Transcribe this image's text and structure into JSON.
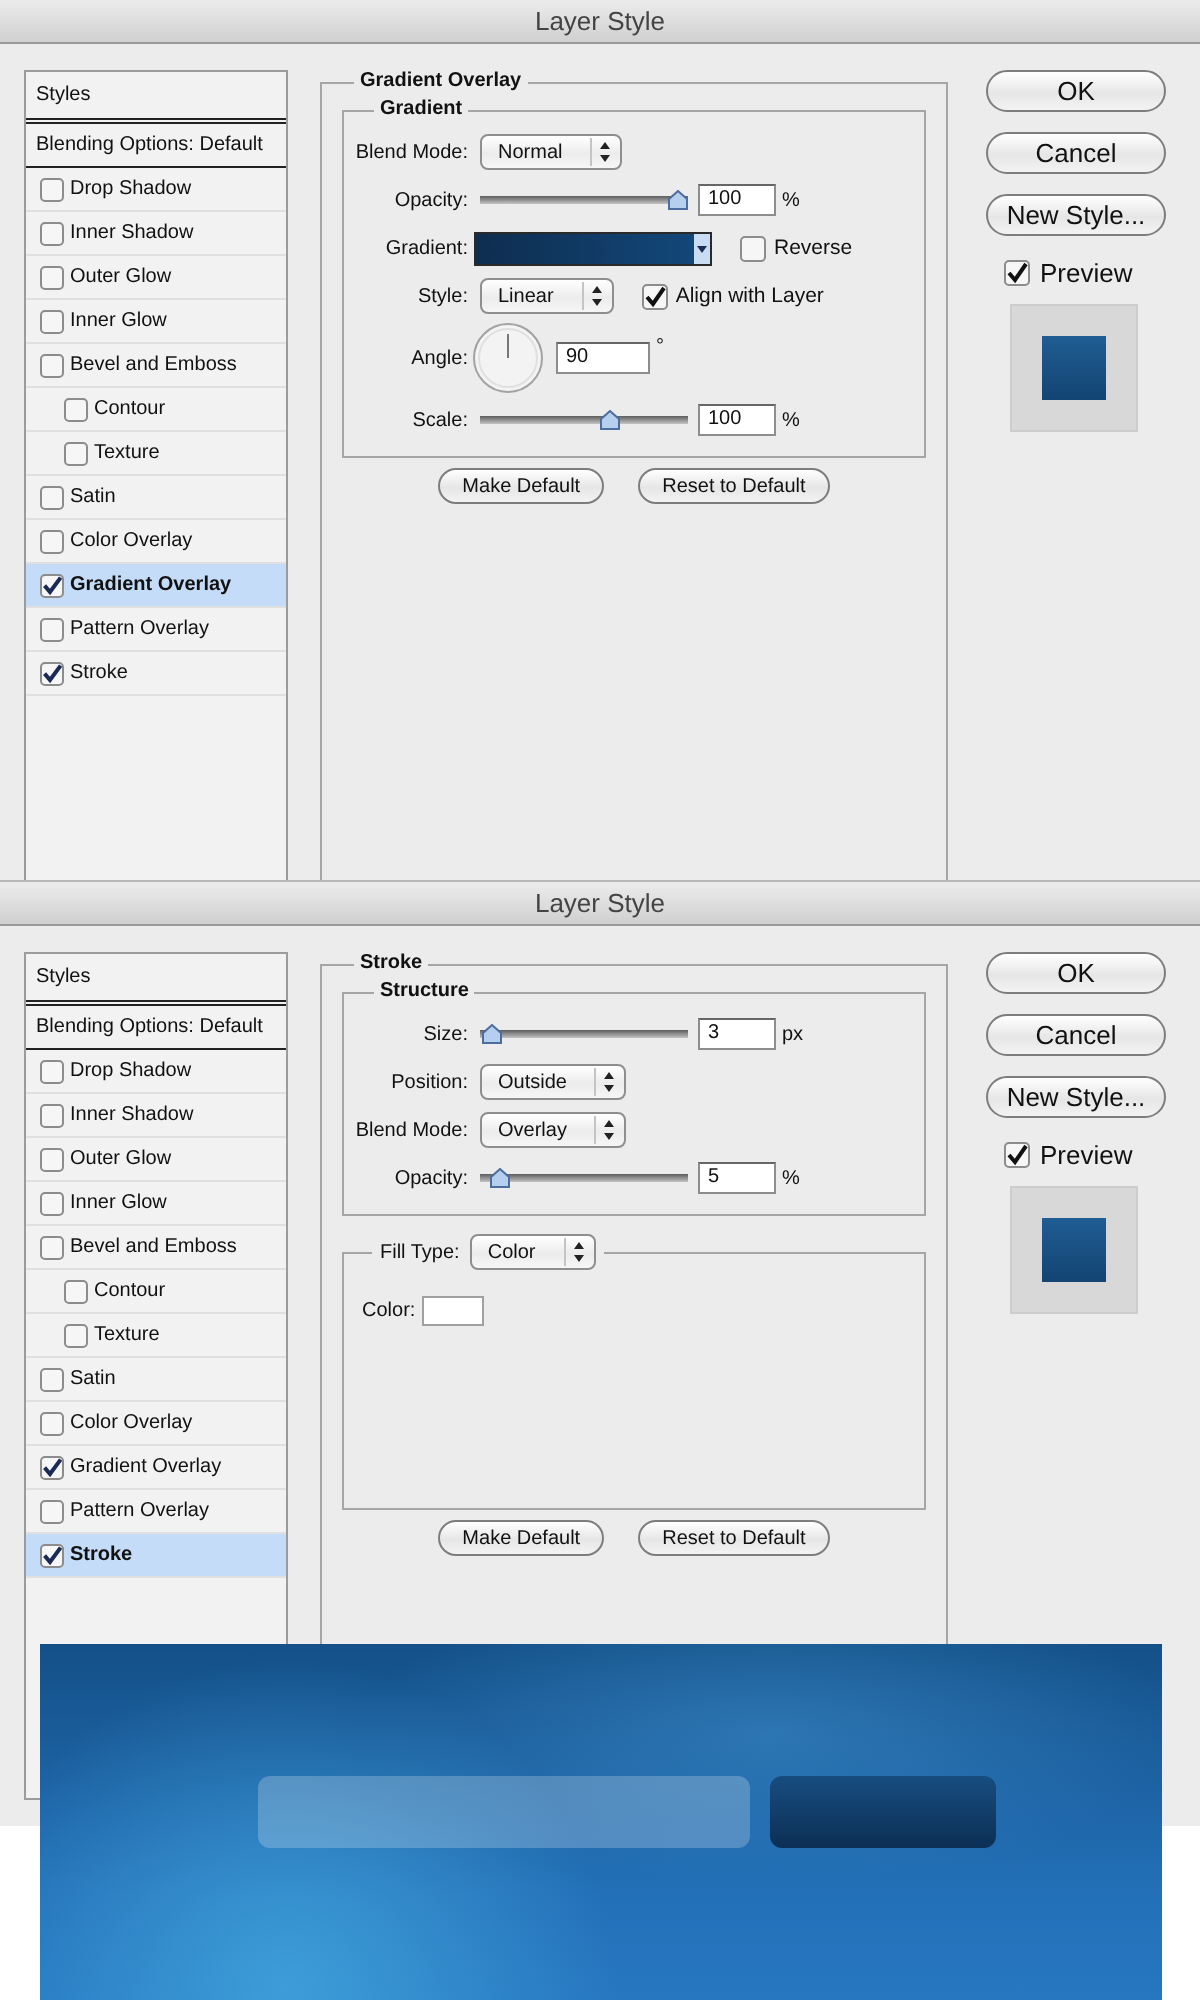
{
  "dialogs": [
    {
      "title": "Layer Style",
      "styles_panel": {
        "items": [
          {
            "kind": "pane",
            "label": "Styles",
            "selected": false
          },
          {
            "kind": "pane",
            "label": "Blending Options: Default",
            "selected": false
          },
          {
            "kind": "effect",
            "label": "Drop Shadow",
            "checked": false,
            "selected": false
          },
          {
            "kind": "effect",
            "label": "Inner Shadow",
            "checked": false,
            "selected": false
          },
          {
            "kind": "effect",
            "label": "Outer Glow",
            "checked": false,
            "selected": false
          },
          {
            "kind": "effect",
            "label": "Inner Glow",
            "checked": false,
            "selected": false
          },
          {
            "kind": "effect",
            "label": "Bevel and Emboss",
            "checked": false,
            "selected": false,
            "children": [
              {
                "kind": "effect",
                "label": "Contour",
                "checked": false,
                "selected": false
              },
              {
                "kind": "effect",
                "label": "Texture",
                "checked": false,
                "selected": false
              }
            ]
          },
          {
            "kind": "effect",
            "label": "Satin",
            "checked": false,
            "selected": false
          },
          {
            "kind": "effect",
            "label": "Color Overlay",
            "checked": false,
            "selected": false
          },
          {
            "kind": "effect",
            "label": "Gradient Overlay",
            "checked": true,
            "selected": true
          },
          {
            "kind": "effect",
            "label": "Pattern Overlay",
            "checked": false,
            "selected": false
          },
          {
            "kind": "effect",
            "label": "Stroke",
            "checked": true,
            "selected": false
          }
        ]
      },
      "settings": {
        "title": "Gradient Overlay",
        "groups": [
          {
            "kind": "titled",
            "title": "Gradient",
            "rows": [
              {
                "kind": "dropdown",
                "label": "Blend Mode:",
                "value": "Normal"
              },
              {
                "kind": "slider",
                "label": "Opacity:",
                "level": 1,
                "value": "100",
                "unit": "%"
              },
              {
                "kind": "gradient",
                "label": "Gradient:",
                "checkbox": {
                  "label": "Reverse",
                  "checked": false
                }
              },
              {
                "kind": "dropdown",
                "label": "Style:",
                "value": "Linear",
                "checkbox": {
                  "label": "Align with Layer",
                  "checked": true
                }
              },
              {
                "kind": "angle",
                "label": "Angle:",
                "value": "90",
                "unit": "°"
              },
              {
                "kind": "slider",
                "label": "Scale:",
                "level": 0.64,
                "value": "100",
                "unit": "%"
              }
            ]
          }
        ],
        "buttons": [
          "Make Default",
          "Reset to Default"
        ]
      },
      "actions": {
        "buttons": [
          "OK",
          "Cancel",
          "New Style..."
        ],
        "preview": {
          "label": "Preview",
          "checked": true
        }
      }
    },
    {
      "title": "Layer Style",
      "styles_panel": {
        "items": [
          {
            "kind": "pane",
            "label": "Styles",
            "selected": false
          },
          {
            "kind": "pane",
            "label": "Blending Options: Default",
            "selected": false
          },
          {
            "kind": "effect",
            "label": "Drop Shadow",
            "checked": false,
            "selected": false
          },
          {
            "kind": "effect",
            "label": "Inner Shadow",
            "checked": false,
            "selected": false
          },
          {
            "kind": "effect",
            "label": "Outer Glow",
            "checked": false,
            "selected": false
          },
          {
            "kind": "effect",
            "label": "Inner Glow",
            "checked": false,
            "selected": false
          },
          {
            "kind": "effect",
            "label": "Bevel and Emboss",
            "checked": false,
            "selected": false,
            "children": [
              {
                "kind": "effect",
                "label": "Contour",
                "checked": false,
                "selected": false
              },
              {
                "kind": "effect",
                "label": "Texture",
                "checked": false,
                "selected": false
              }
            ]
          },
          {
            "kind": "effect",
            "label": "Satin",
            "checked": false,
            "selected": false
          },
          {
            "kind": "effect",
            "label": "Color Overlay",
            "checked": false,
            "selected": false
          },
          {
            "kind": "effect",
            "label": "Gradient Overlay",
            "checked": true,
            "selected": false
          },
          {
            "kind": "effect",
            "label": "Pattern Overlay",
            "checked": false,
            "selected": false
          },
          {
            "kind": "effect",
            "label": "Stroke",
            "checked": true,
            "selected": true
          }
        ]
      },
      "settings": {
        "title": "Stroke",
        "groups": [
          {
            "kind": "titled",
            "title": "Structure",
            "rows": [
              {
                "kind": "slider",
                "label": "Size:",
                "level": 0.01,
                "value": "3",
                "unit": "px"
              },
              {
                "kind": "dropdown",
                "label": "Position:",
                "value": "Outside"
              },
              {
                "kind": "dropdown",
                "label": "Blend Mode:",
                "value": "Overlay"
              },
              {
                "kind": "slider",
                "label": "Opacity:",
                "level": 0.05,
                "value": "5",
                "unit": "%"
              }
            ]
          },
          {
            "kind": "dropdown",
            "label": "Fill Type:",
            "value": "Color",
            "rows": [
              {
                "kind": "color",
                "label": "Color:"
              }
            ]
          }
        ],
        "buttons": [
          "Make Default",
          "Reset to Default"
        ]
      },
      "actions": {
        "buttons": [
          "OK",
          "Cancel",
          "New Style..."
        ],
        "preview": {
          "label": "Preview",
          "checked": true
        }
      }
    }
  ],
  "banner": {
    "elements": [
      {
        "kind": "input"
      },
      {
        "kind": "button"
      }
    ]
  }
}
